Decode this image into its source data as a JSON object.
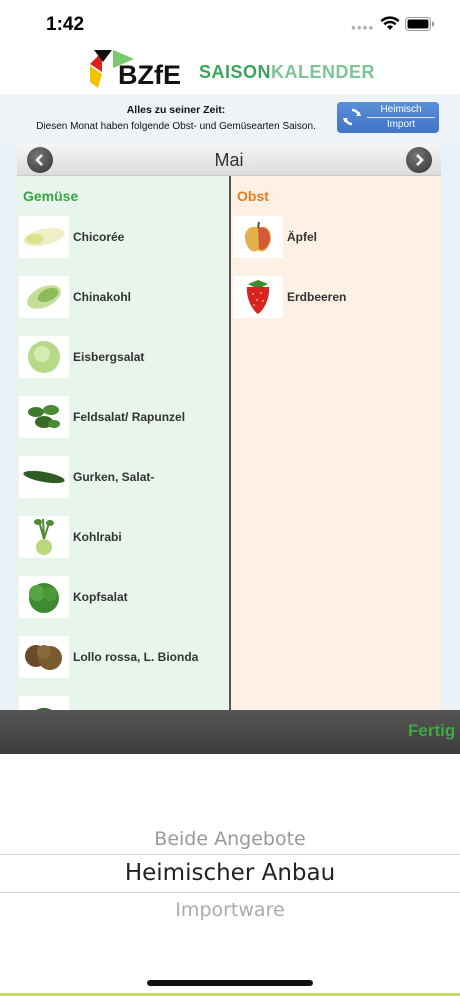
{
  "status": {
    "time": "1:42",
    "signal_icon": "signal-dots-icon",
    "wifi_icon": "wifi-icon",
    "battery_icon": "battery-icon"
  },
  "header": {
    "logo": "BZfE",
    "app_title_part1": "SAISON",
    "app_title_part2": "KALENDER"
  },
  "info": {
    "line1": "Alles zu seiner Zeit:",
    "line2": "Diesen Monat haben folgende Obst- und Gemüsearten Saison."
  },
  "toggle": {
    "option1": "Heimisch",
    "option2": "Import",
    "icon": "refresh-icon"
  },
  "month": {
    "label": "Mai",
    "prev_icon": "chevron-left-icon",
    "next_icon": "chevron-right-icon"
  },
  "vegetables": {
    "title": "Gemüse",
    "items": [
      {
        "name": "Chicorée"
      },
      {
        "name": "Chinakohl"
      },
      {
        "name": "Eisbergsalat"
      },
      {
        "name": "Feldsalat/ Rapunzel"
      },
      {
        "name": "Gurken, Salat-"
      },
      {
        "name": "Kohlrabi"
      },
      {
        "name": "Kopfsalat"
      },
      {
        "name": "Lollo rossa, L. Bionda"
      }
    ]
  },
  "fruits": {
    "title": "Obst",
    "items": [
      {
        "name": "Äpfel"
      },
      {
        "name": "Erdbeeren"
      }
    ]
  },
  "picker": {
    "done_label": "Fertig",
    "options": [
      "Beide Angebote",
      "Heimischer Anbau",
      "Importware"
    ],
    "selected": "Heimischer Anbau"
  },
  "colors": {
    "green_accent": "#3aa43e",
    "orange_accent": "#ee7a1f",
    "toggle_blue": "#4a80cf"
  }
}
